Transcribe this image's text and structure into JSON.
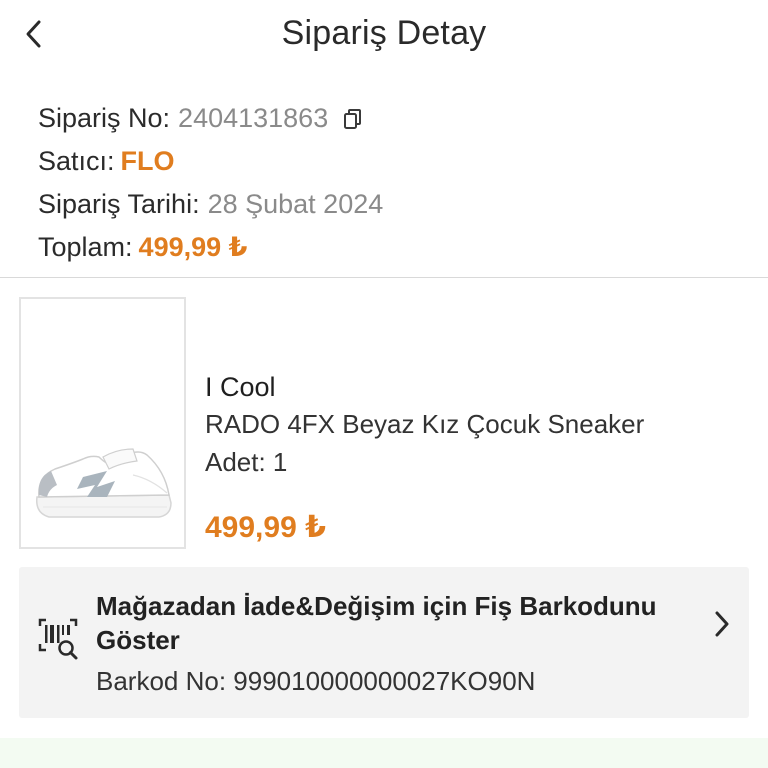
{
  "header": {
    "title": "Sipariş Detay",
    "back_icon": "chevron-left-icon"
  },
  "order": {
    "order_no_label": "Sipariş No:",
    "order_no_value": "2404131863",
    "copy_icon": "copy-icon",
    "seller_label": "Satıcı:",
    "seller_value": "FLO",
    "date_label": "Sipariş Tarihi:",
    "date_value": "28 Şubat 2024",
    "total_label": "Toplam:",
    "total_value": "499,99 ₺"
  },
  "product": {
    "image": "white-sneaker-with-grey-stripes",
    "brand": "I Cool",
    "name": "RADO 4FX Beyaz Kız Çocuk Sneaker",
    "quantity": "Adet: 1",
    "price": "499,99 ₺"
  },
  "barcode": {
    "icon": "barcode-search-icon",
    "title": "Mağazadan İade&Değişim için Fiş Barkodunu Göster",
    "number": "Barkod No: 999010000000027KO90N",
    "chevron_icon": "chevron-right-icon"
  },
  "colors": {
    "accent": "#e07d1f",
    "muted_text": "#8a8a8a",
    "card_background": "#f3f3f3",
    "divider": "#d9d9d9",
    "bottom_strip": "#f3fbf2"
  }
}
